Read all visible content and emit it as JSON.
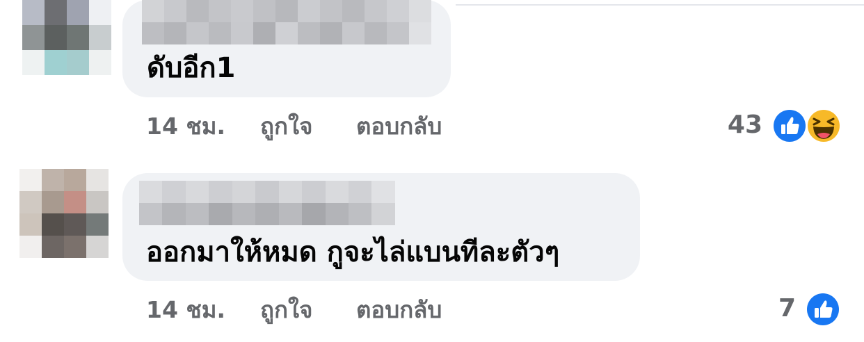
{
  "comments": [
    {
      "text": "ดับอีก1",
      "time": "14 ชม.",
      "like_label": "ถูกใจ",
      "reply_label": "ตอบกลับ",
      "reaction_count": "43",
      "reactions": [
        "like-icon",
        "haha-icon"
      ]
    },
    {
      "text": "ออกมาให้หมด กูจะไล่แบนทีละตัวๆ",
      "time": "14 ชม.",
      "like_label": "ถูกใจ",
      "reply_label": "ตอบกลับ",
      "reaction_count": "7",
      "reactions": [
        "like-icon"
      ]
    }
  ],
  "colors": {
    "bubble": "#f0f2f5",
    "meta_text": "#65676b",
    "comment_text": "#050505",
    "like_blue": "#1877f2",
    "haha_yellow": "#f7b928"
  }
}
